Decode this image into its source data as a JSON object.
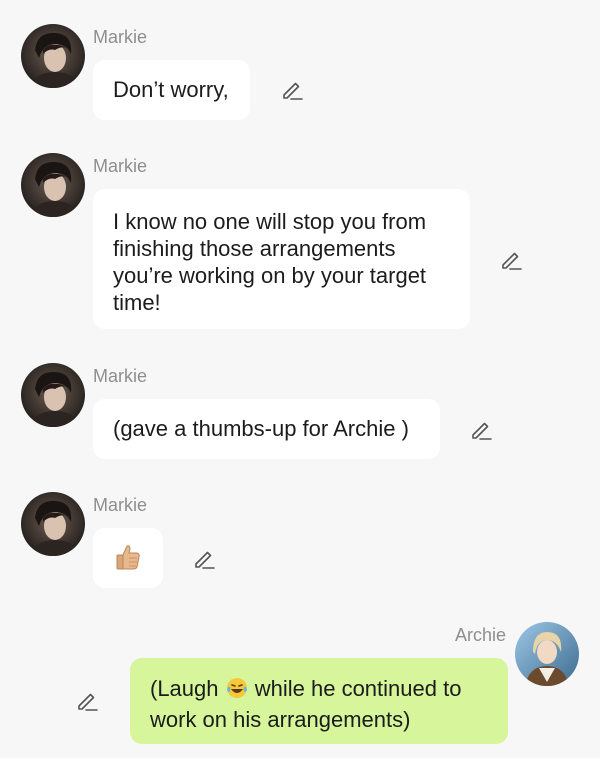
{
  "messages": [
    {
      "sender": "Markie",
      "text": "Don’t worry,"
    },
    {
      "sender": "Markie",
      "lines": [
        "I know no one will stop you from",
        "finishing those arrangements",
        "you’re working on by your target",
        "time!"
      ]
    },
    {
      "sender": "Markie",
      "text": "(gave a thumbs-up for Archie )"
    },
    {
      "sender": "Markie",
      "emoji_icon": "thumbs-up-icon"
    },
    {
      "sender": "Archie",
      "line1_before": "(Laugh ",
      "line1_after": " while he continued to",
      "line2": "work on his arrangements)",
      "emoji_icon": "laughing-tears-icon"
    }
  ],
  "colors": {
    "background": "#f7f7f7",
    "incoming_bubble": "#ffffff",
    "outgoing_bubble": "#d7f59a",
    "name_text": "#8e8e8e",
    "message_text": "#1c1c1c"
  },
  "icons": {
    "edit": "pencil-edit-icon",
    "avatar_markie": "markie-avatar",
    "avatar_archie": "archie-avatar"
  }
}
